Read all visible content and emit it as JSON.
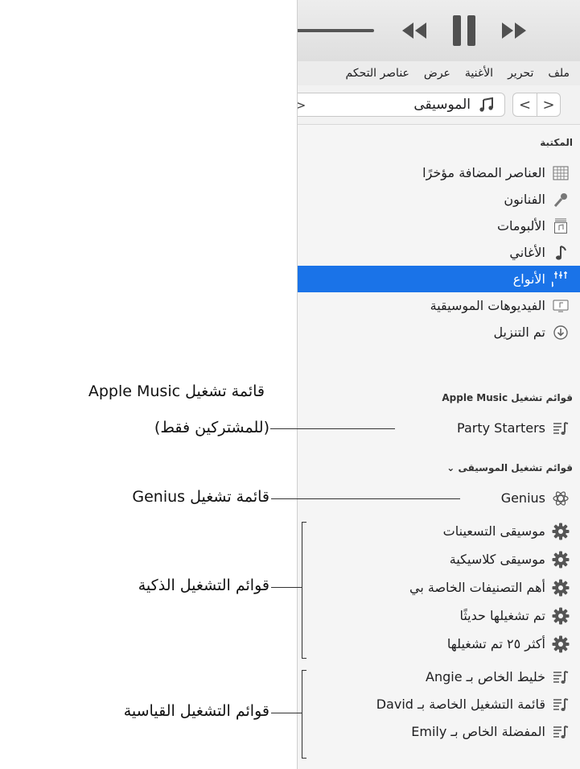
{
  "menu": [
    "ملف",
    "تحرير",
    "الأغنية",
    "عرض",
    "عناصر التحكم"
  ],
  "navigation": {
    "back": "<",
    "forward": ">",
    "media_kind": "الموسيقى",
    "menu_glyph": "<"
  },
  "library": {
    "heading": "المكتبة",
    "items": [
      {
        "label": "العناصر المضافة مؤخرًا",
        "icon": "recently-added-icon"
      },
      {
        "label": "الفنانون",
        "icon": "microphone-icon"
      },
      {
        "label": "الألبومات",
        "icon": "album-icon"
      },
      {
        "label": "الأغاني",
        "icon": "music-note-icon"
      },
      {
        "label": "الأنواع",
        "icon": "genres-icon",
        "selected": true
      },
      {
        "label": "الفيديوهات الموسيقية",
        "icon": "music-video-icon"
      },
      {
        "label": "تم التنزيل",
        "icon": "download-icon"
      }
    ]
  },
  "apple_music_playlists": {
    "heading": "قوائم تشغيل Apple Music",
    "items": [
      {
        "label": "Party Starters",
        "icon": "playlist-icon"
      }
    ]
  },
  "music_playlists": {
    "heading": "قوائم تشغيل الموسيقى ⌄",
    "genius": {
      "label": "Genius",
      "icon": "genius-icon"
    },
    "smart": [
      {
        "label": "موسيقى التسعينات",
        "icon": "gear-icon"
      },
      {
        "label": "موسيقى كلاسيكية",
        "icon": "gear-icon"
      },
      {
        "label": "أهم التصنيفات الخاصة بي",
        "icon": "gear-icon"
      },
      {
        "label": "تم تشغيلها حديثًا",
        "icon": "gear-icon"
      },
      {
        "label": "أكثر ٢٥ تم تشغيلها",
        "icon": "gear-icon"
      }
    ],
    "standard": [
      {
        "label": "خليط الخاص بـ Angie",
        "icon": "playlist-icon"
      },
      {
        "label": "قائمة التشغيل الخاصة بـ David",
        "icon": "playlist-icon"
      },
      {
        "label": "المفضلة الخاص بـ Emily",
        "icon": "playlist-icon"
      }
    ]
  },
  "callouts": {
    "apple_music_line1": "قائمة تشغيل Apple Music",
    "apple_music_line2": "(للمشتركين فقط)",
    "genius": "قائمة تشغيل Genius",
    "smart": "قوائم التشغيل الذكية",
    "standard": "قوائم التشغيل القياسية"
  },
  "colors": {
    "selection": "#1a73e8",
    "icon_gray": "#606060"
  }
}
